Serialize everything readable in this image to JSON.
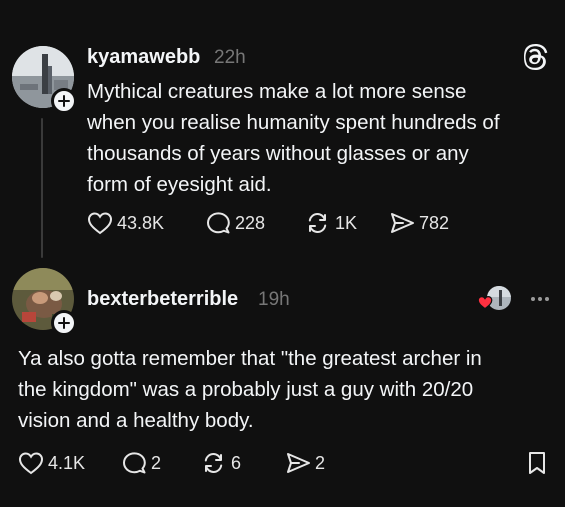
{
  "posts": [
    {
      "username": "kyamawebb",
      "time": "22h",
      "lines": [
        "Mythical creatures make a lot more sense",
        "when you realise humanity spent hundreds of",
        "thousands of years without glasses or any",
        "form of eyesight aid."
      ],
      "likes": "43.8K",
      "replies": "228",
      "reposts": "1K",
      "shares": "782"
    },
    {
      "username": "bexterbeterrible",
      "time": "19h",
      "lines": [
        "Ya also gotta remember that \"the greatest archer in",
        "the kingdom\" was a probably just a guy with 20/20",
        "vision and a healthy body."
      ],
      "likes": "4.1K",
      "replies": "2",
      "reposts": "6",
      "shares": "2"
    }
  ],
  "icons": {
    "like": "heart-icon",
    "reply": "comment-icon",
    "repost": "repost-icon",
    "share": "send-icon",
    "logo": "threads-logo-icon",
    "more": "more-icon",
    "save": "bookmark-icon"
  },
  "colors": {
    "background": "#101010",
    "text": "#f3f5f7",
    "muted": "#777777",
    "like_badge": "#ff3040"
  }
}
